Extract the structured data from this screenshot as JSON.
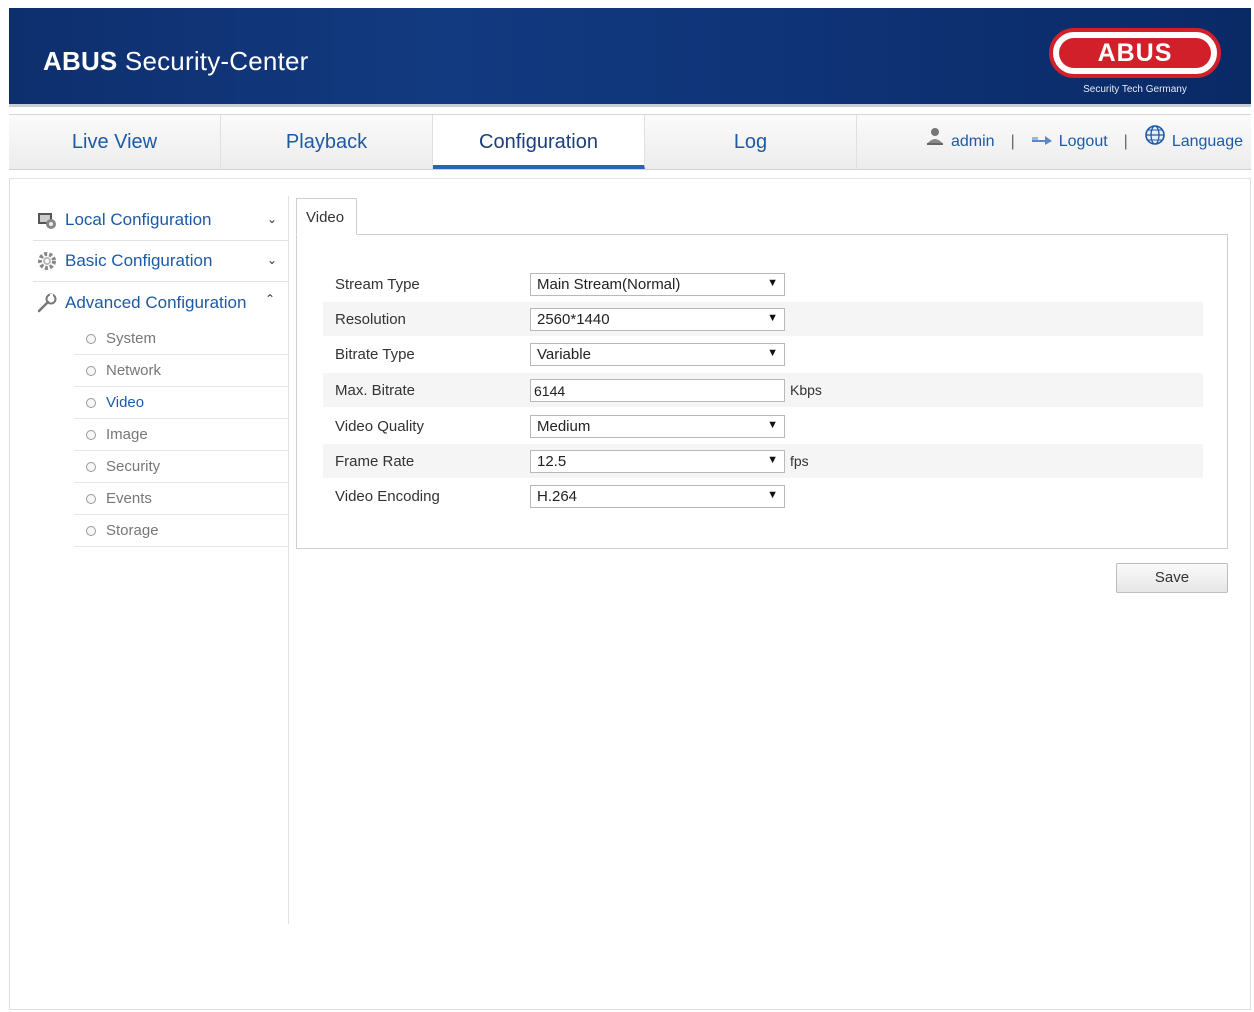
{
  "header": {
    "title_brand": "ABUS",
    "title_rest": " Security-Center",
    "logo_text": "ABUS",
    "logo_tagline": "Security Tech Germany"
  },
  "nav": {
    "tabs": [
      {
        "label": "Live View"
      },
      {
        "label": "Playback"
      },
      {
        "label": "Configuration",
        "active": true
      },
      {
        "label": "Log"
      }
    ],
    "user": "admin",
    "separator": "|",
    "logout": "Logout",
    "language": "Language"
  },
  "sidebar": {
    "sections": [
      {
        "label": "Local Configuration",
        "icon": "monitor-gear-icon",
        "state": "collapsed"
      },
      {
        "label": "Basic Configuration",
        "icon": "gear-icon",
        "state": "collapsed"
      },
      {
        "label": "Advanced Configuration",
        "icon": "wrench-icon",
        "state": "expanded"
      }
    ],
    "items": [
      {
        "label": "System"
      },
      {
        "label": "Network"
      },
      {
        "label": "Video",
        "active": true
      },
      {
        "label": "Image"
      },
      {
        "label": "Security"
      },
      {
        "label": "Events"
      },
      {
        "label": "Storage"
      }
    ]
  },
  "content": {
    "tab": "Video",
    "fields": [
      {
        "label": "Stream Type",
        "type": "select",
        "value": "Main Stream(Normal)"
      },
      {
        "label": "Resolution",
        "type": "select",
        "value": "2560*1440"
      },
      {
        "label": "Bitrate Type",
        "type": "select",
        "value": "Variable"
      },
      {
        "label": "Max. Bitrate",
        "type": "text",
        "value": "6144",
        "unit": "Kbps"
      },
      {
        "label": "Video Quality",
        "type": "select",
        "value": "Medium"
      },
      {
        "label": "Frame Rate",
        "type": "select",
        "value": "12.5",
        "unit": "fps"
      },
      {
        "label": "Video Encoding",
        "type": "select",
        "value": "H.264"
      }
    ],
    "save_label": "Save"
  },
  "colors": {
    "header_blue": "#123a80",
    "link_blue": "#1d5aa6",
    "logo_red": "#d2202a"
  }
}
